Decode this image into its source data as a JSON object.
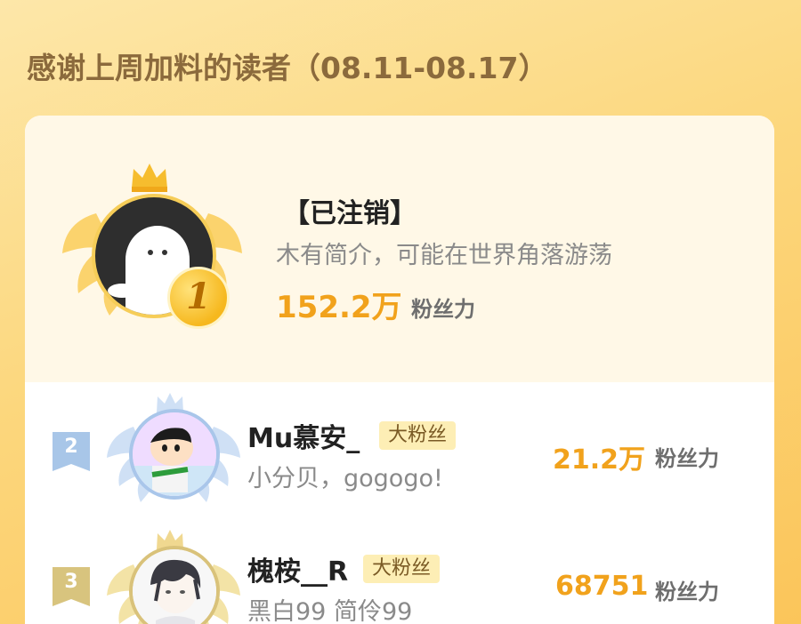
{
  "header": {
    "title": "感谢上周加料的读者（08.11-08.17）"
  },
  "first": {
    "rank": "1",
    "name": "【已注销】",
    "bio": "木有简介，可能在世界角落游荡",
    "score": "152.2万",
    "unit": "粉丝力",
    "avatar": "default-ghost-avatar"
  },
  "ranks": [
    {
      "rank": "2",
      "name": "Mu慕安_",
      "tag": "大粉丝",
      "bio": "小分贝，gogogo!",
      "score": "21.2万",
      "unit": "粉丝力",
      "avatar": "cartoon-boy-avatar"
    },
    {
      "rank": "3",
      "name": "槐桉__R",
      "tag": "大粉丝",
      "bio": "黑白99 简伶99",
      "score": "68751",
      "unit": "粉丝力",
      "avatar": "anime-boy-avatar"
    }
  ],
  "colors": {
    "gold": "#f1a21c",
    "silver": "#a9c6ea",
    "bronze": "#d9c27a",
    "tag_bg": "#fdeeb5"
  }
}
